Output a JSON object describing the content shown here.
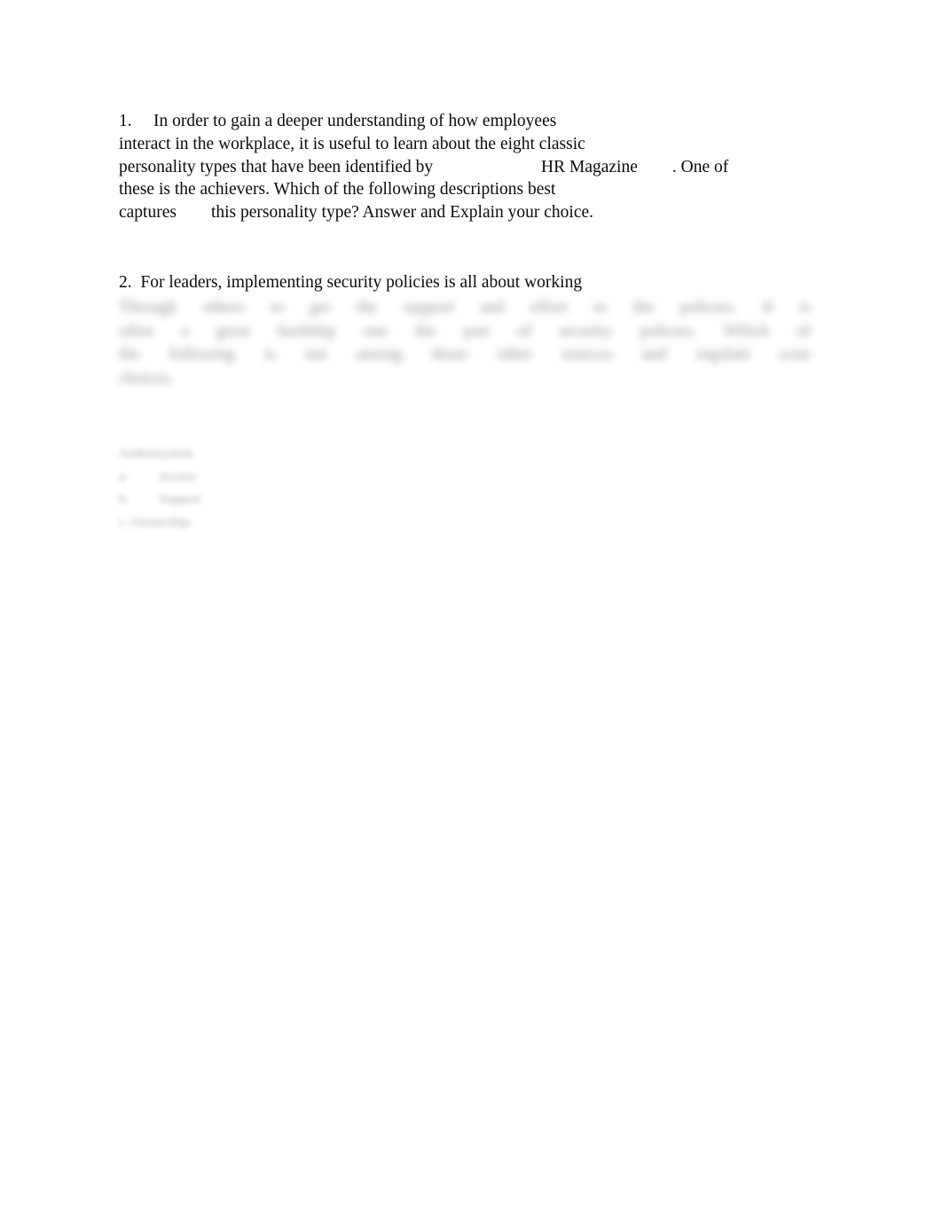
{
  "document": {
    "background_color": "#ffffff",
    "text_color": "#0b0b0b",
    "redacted_text_color": "#4d4d4d"
  },
  "question_1": {
    "number": "1.",
    "lines": [
      "1.\tIn order to gain a deeper understanding of how employees",
      "interact in the workplace, it is useful to learn about the eight classic",
      "personality types that have been identified by                         HR Magazine        . One of",
      "these is the achievers. Which of the following descriptions best",
      "captures        this personality type? Answer and Explain your choice."
    ],
    "cited_source": "HR Magazine"
  },
  "question_2": {
    "heading": "2.  For leaders, implementing security policies is all about working",
    "body_lines": [
      [
        "Through",
        "others",
        "to",
        "get",
        "the",
        "support",
        "and",
        "effort",
        "to",
        "the",
        "policies.",
        "It",
        "is"
      ],
      [
        "often",
        "a",
        "great",
        "hardship",
        "one",
        "the",
        "part",
        "of",
        "security",
        "policies.",
        "Which",
        "of"
      ],
      [
        "the",
        "following",
        "is",
        "not",
        "among",
        "those",
        "other",
        "sources",
        "and",
        "regulate",
        "your"
      ],
      [
        "choices."
      ]
    ],
    "body_redacted": true,
    "options_redacted": true,
    "options_lines": [
      "Authorization",
      "a.\t    Access",
      "b.\t    Support",
      "c. Ownership"
    ]
  }
}
